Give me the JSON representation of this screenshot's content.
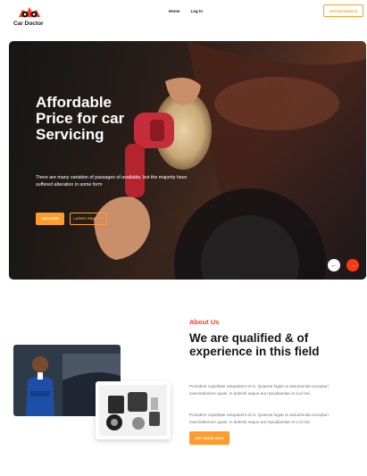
{
  "brand": {
    "name": "Car Doctor",
    "accent": "#FF3811",
    "accent_soft": "#FF9D2C"
  },
  "nav": {
    "items": [
      {
        "label": "Home"
      },
      {
        "label": "Log In"
      }
    ]
  },
  "header": {
    "appointment_label": "APPOINTMENTS"
  },
  "hero": {
    "title": "Affordable Price for car Servicing",
    "description": "There are many variation of passages of available, but the majority have suffered alteration in some form",
    "discover_label": "DISCOVER",
    "latest_label": "LATEST PROJECT",
    "prev_icon": "arrow-left-icon",
    "next_icon": "arrow-right-icon",
    "prev_glyph": "←",
    "next_glyph": "→"
  },
  "about": {
    "label": "About Us",
    "title": "We are qualified & of experience in this field",
    "paragraph1": "Provident cupiditate voluptatem et in. Quaerat fugiat ut assumenda excepturi exercitationem quasi. In deleniti eaque aut repudiandae et a id nisi.",
    "paragraph2": "Provident cupiditate voluptatem et in. Quaerat fugiat ut assumenda excepturi exercitationem quasi. In deleniti eaque aut repudiandae et a id nisi.",
    "button_label": "GET MORE INFO"
  }
}
